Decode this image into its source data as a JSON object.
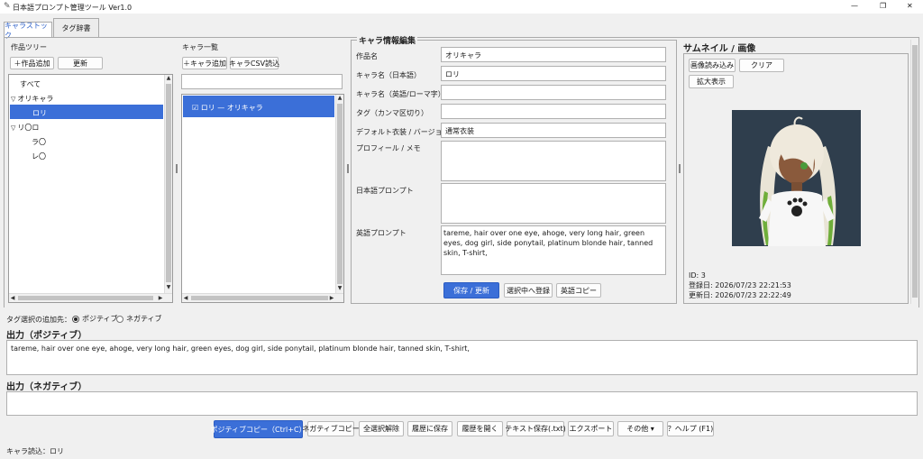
{
  "window": {
    "title": "日本語プロンプト管理ツール Ver1.0",
    "controls": [
      "—",
      "❐",
      "✕"
    ]
  },
  "tabs": [
    {
      "label": "キャラストック",
      "active": true
    },
    {
      "label": "タグ辞書",
      "active": false
    }
  ],
  "tree": {
    "header": "作品ツリー",
    "add_label": "＋作品追加",
    "refresh_label": "更新",
    "items": [
      {
        "label": "すべて",
        "indent": 0,
        "selected": false
      },
      {
        "label": "オリキャラ",
        "indent": 0,
        "selected": false,
        "expander": "▽"
      },
      {
        "label": "ロリ",
        "indent": 1,
        "selected": true
      },
      {
        "label": "リ〇ロ",
        "indent": 0,
        "selected": false,
        "expander": "▽"
      },
      {
        "label": "ラ〇",
        "indent": 1,
        "selected": false
      },
      {
        "label": "レ〇",
        "indent": 1,
        "selected": false
      }
    ]
  },
  "charlist": {
    "header": "キャラ一覧",
    "add_label": "＋キャラ追加",
    "csv_label": "キャラCSV読込",
    "search_value": "",
    "items": [
      {
        "check": "☑",
        "label": "ロリ — オリキャラ",
        "selected": true
      }
    ]
  },
  "details": {
    "header": "キャラ情報編集",
    "fields": [
      {
        "label": "作品名",
        "value": "オリキャラ"
      },
      {
        "label": "キャラ名（日本語）",
        "value": "ロリ"
      },
      {
        "label": "キャラ名（英語/ローマ字）",
        "value": ""
      },
      {
        "label": "タグ（カンマ区切り）",
        "value": ""
      },
      {
        "label": "デフォルト衣装 / バージョン",
        "value": "通常衣装"
      }
    ],
    "profile_label": "プロフィール / メモ",
    "profile_value": "",
    "jp_prompt_label": "日本語プロンプト",
    "jp_prompt_value": "",
    "en_prompt_label": "英語プロンプト",
    "en_prompt_value": "tareme, hair over one eye, ahoge, very long hair, green eyes, dog girl, side ponytail, platinum blonde hair, tanned skin, T-shirt,",
    "save_label": "保存 / 更新",
    "register_label": "選択中へ登録",
    "copy_en_label": "英語コピー"
  },
  "thumbnail": {
    "header": "サムネイル / 画像",
    "load_label": "画像読み込み",
    "clear_label": "クリア",
    "zoom_label": "拡大表示",
    "id_text": "ID: 3",
    "created_text": "登録日: 2026/07/23 22:21:53",
    "updated_text": "更新日: 2026/07/23 22:22:49"
  },
  "tag_target": {
    "label": "タグ選択の追加先：",
    "options": [
      {
        "label": "ポジティブ",
        "checked": true
      },
      {
        "label": "ネガティブ",
        "checked": false
      }
    ]
  },
  "output_positive": {
    "header": "出力（ポジティブ）",
    "value": "tareme, hair over one eye, ahoge, very long hair, green eyes, dog girl, side ponytail, platinum blonde hair, tanned skin, T-shirt,"
  },
  "output_negative": {
    "header": "出力（ネガティブ）",
    "value": ""
  },
  "toolbar": {
    "copy_positive": "ポジティブコピー（Ctrl+C）",
    "copy_negative": "ネガティブコピー",
    "deselect_all": "全選択解除",
    "save_history": "履歴に保存",
    "open_history": "履歴を開く",
    "save_text": "テキスト保存(.txt)",
    "export": "エクスポート",
    "other": "その他 ▾",
    "help": "？ヘルプ (F1)"
  },
  "status": "キャラ読込：ロリ",
  "colors": {
    "accent": "#3b6fd8",
    "thumb_bg": "#2f3e4d"
  }
}
